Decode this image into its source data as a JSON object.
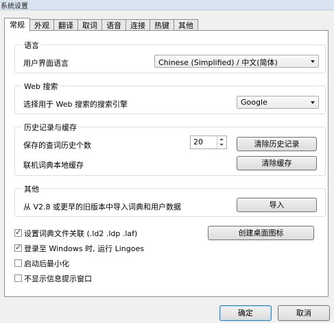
{
  "window": {
    "title": "系统设置"
  },
  "tabs": [
    {
      "label": "常规",
      "active": true
    },
    {
      "label": "外观"
    },
    {
      "label": "翻译"
    },
    {
      "label": "取词"
    },
    {
      "label": "语音"
    },
    {
      "label": "连接"
    },
    {
      "label": "热键"
    },
    {
      "label": "其他"
    }
  ],
  "language": {
    "legend": "语言",
    "ui_label": "用户界面语言",
    "ui_value": "Chinese (Simplified)  /  中文(简体)"
  },
  "web_search": {
    "legend": "Web 搜索",
    "engine_label": "选择用于 Web 搜索的搜索引擎",
    "engine_value": "Google"
  },
  "history": {
    "legend": "历史记录与缓存",
    "count_label": "保存的查词历史个数",
    "count_value": "20",
    "clear_history": "清除历史记录",
    "cache_label": "联机词典本地缓存",
    "clear_cache": "清除缓存"
  },
  "other": {
    "legend": "其他",
    "import_label": "从 V2.8 或更早的旧版本中导入词典和用户数据",
    "import_button": "导入"
  },
  "options": [
    {
      "label": "设置词典文件关联 (.ld2 .ldp .laf)",
      "checked": true
    },
    {
      "label": "登录至 Windows 时, 运行 Lingoes",
      "checked": true
    },
    {
      "label": "启动后最小化",
      "checked": false
    },
    {
      "label": "不显示信息提示窗口",
      "checked": false
    }
  ],
  "desktop_icon_button": "创建桌面图标",
  "footer": {
    "ok": "确定",
    "cancel": "取消"
  }
}
